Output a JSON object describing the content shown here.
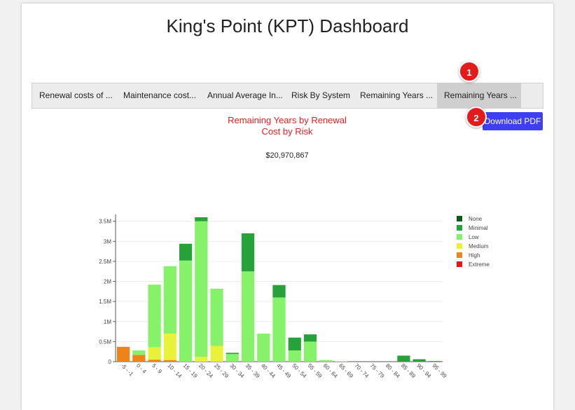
{
  "page": {
    "title": "King's Point (KPT) Dashboard"
  },
  "tabs": [
    {
      "label": "Renewal costs of ...",
      "active": false
    },
    {
      "label": "Maintenance cost...",
      "active": false
    },
    {
      "label": "Annual Average In...",
      "active": false
    },
    {
      "label": "Risk By System",
      "active": false
    },
    {
      "label": "Remaining Years ...",
      "active": false
    },
    {
      "label": "Remaining Years ...",
      "active": true
    }
  ],
  "callouts": {
    "first": "1",
    "second": "2"
  },
  "download_button": {
    "label": "Download PDF",
    "color": "#3f3ff2"
  },
  "chart_data": {
    "type": "bar",
    "stacked": true,
    "title": "Remaining Years by Renewal Cost by Risk",
    "title_lines": [
      "Remaining Years by Renewal",
      "Cost by Risk"
    ],
    "total": "$20,970,867",
    "categories": [
      "-5 - -1",
      "0 - 4",
      "5 - 9",
      "10 - 14",
      "15 - 19",
      "20 - 24",
      "25 - 29",
      "30 - 34",
      "35 - 39",
      "40 - 44",
      "45 - 49",
      "50 - 54",
      "55 - 59",
      "60 - 64",
      "65 - 69",
      "70 - 74",
      "75 - 79",
      "80 - 84",
      "85 - 89",
      "90 - 94",
      "95 - 99"
    ],
    "y_ticks": [
      {
        "value": 0,
        "label": "0"
      },
      {
        "value": 500000,
        "label": "0.5M"
      },
      {
        "value": 1000000,
        "label": "1M"
      },
      {
        "value": 1500000,
        "label": "1.5M"
      },
      {
        "value": 2000000,
        "label": "2M"
      },
      {
        "value": 2500000,
        "label": "2.5M"
      },
      {
        "value": 3000000,
        "label": "3M"
      },
      {
        "value": 3500000,
        "label": "3.5M"
      }
    ],
    "ylim": [
      0,
      3600000
    ],
    "series": [
      {
        "name": "None",
        "color": "#0a5a1a",
        "values": [
          0,
          0,
          0,
          0,
          0,
          0,
          0,
          0,
          0,
          0,
          0,
          0,
          0,
          0,
          0,
          0,
          0,
          0,
          0,
          0,
          0
        ]
      },
      {
        "name": "Minimal",
        "color": "#27a13a",
        "values": [
          0,
          0,
          0,
          0,
          420000,
          100000,
          0,
          30000,
          950000,
          0,
          310000,
          320000,
          180000,
          0,
          0,
          0,
          0,
          0,
          150000,
          60000,
          15000
        ]
      },
      {
        "name": "Low",
        "color": "#86f26a",
        "values": [
          0,
          110000,
          1560000,
          1680000,
          2520000,
          3380000,
          1430000,
          190000,
          2250000,
          700000,
          1600000,
          280000,
          500000,
          40000,
          10000,
          0,
          0,
          0,
          0,
          0,
          0
        ]
      },
      {
        "name": "Medium",
        "color": "#e8f23a",
        "values": [
          0,
          0,
          310000,
          660000,
          0,
          120000,
          390000,
          0,
          0,
          0,
          0,
          0,
          0,
          0,
          0,
          0,
          0,
          0,
          0,
          0,
          0
        ]
      },
      {
        "name": "High",
        "color": "#ee8418",
        "values": [
          370000,
          170000,
          50000,
          40000,
          0,
          0,
          0,
          0,
          0,
          0,
          0,
          0,
          0,
          0,
          0,
          0,
          0,
          0,
          0,
          0,
          0
        ]
      },
      {
        "name": "Extreme",
        "color": "#ee1414",
        "values": [
          0,
          0,
          0,
          0,
          0,
          0,
          0,
          0,
          0,
          0,
          0,
          0,
          0,
          0,
          0,
          0,
          0,
          0,
          0,
          0,
          0
        ]
      }
    ],
    "stack_order": [
      "High",
      "Medium",
      "Low",
      "Minimal",
      "None",
      "Extreme"
    ],
    "legend": [
      "None",
      "Minimal",
      "Low",
      "Medium",
      "High",
      "Extreme"
    ],
    "legend_position": "right",
    "grid": true
  }
}
